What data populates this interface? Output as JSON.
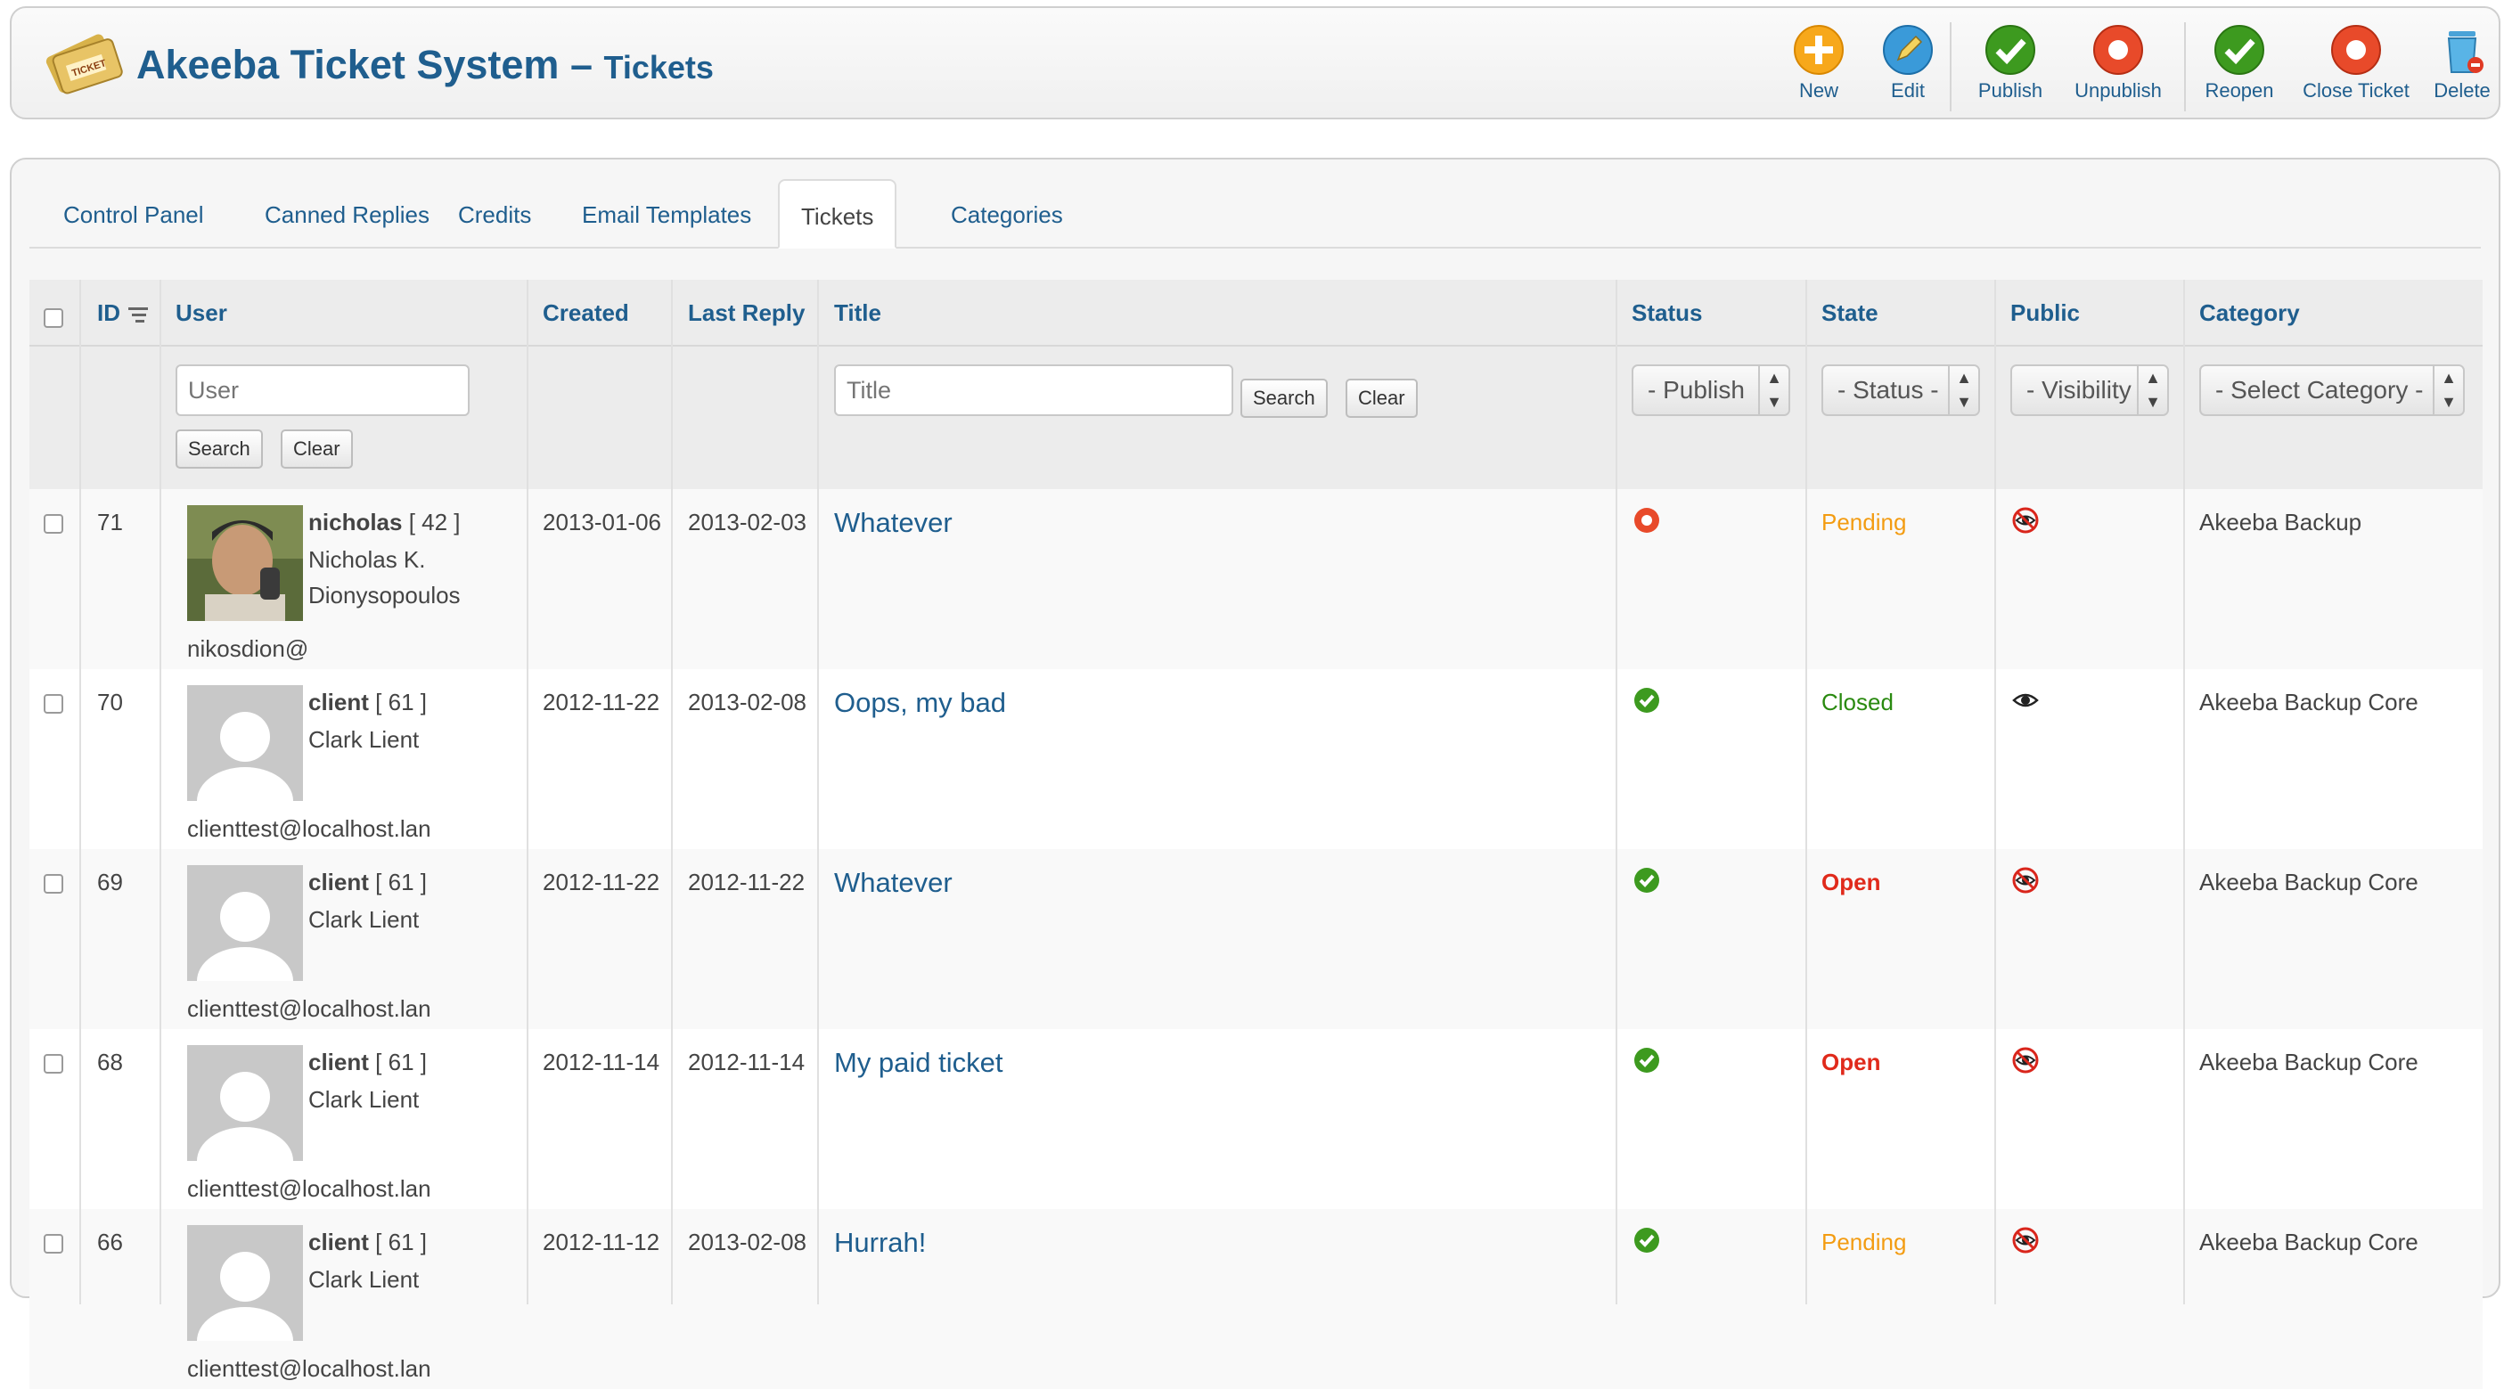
{
  "app": {
    "title": "Akeeba Ticket System",
    "dash": "–",
    "subtitle": "Tickets"
  },
  "toolbar": {
    "buttons": [
      {
        "label": "New",
        "icon": "plus-icon"
      },
      {
        "label": "Edit",
        "icon": "pencil-icon"
      },
      {
        "label": "Publish",
        "icon": "check-icon"
      },
      {
        "label": "Unpublish",
        "icon": "stop-icon"
      },
      {
        "label": "Reopen",
        "icon": "check-icon"
      },
      {
        "label": "Close Ticket",
        "icon": "stop-icon"
      },
      {
        "label": "Delete",
        "icon": "trash-icon"
      }
    ]
  },
  "tabs": [
    {
      "label": "Control Panel",
      "active": false
    },
    {
      "label": "Canned Replies",
      "active": false
    },
    {
      "label": "Credits",
      "active": false
    },
    {
      "label": "Email Templates",
      "active": false
    },
    {
      "label": "Tickets",
      "active": true
    },
    {
      "label": "Categories",
      "active": false
    }
  ],
  "table": {
    "columns": {
      "id": "ID",
      "user": "User",
      "created": "Created",
      "last_reply": "Last Reply",
      "title": "Title",
      "status": "Status",
      "state": "State",
      "public": "Public",
      "category": "Category"
    },
    "filters": {
      "user_placeholder": "User",
      "title_placeholder": "Title",
      "search_label": "Search",
      "clear_label": "Clear",
      "status_select": "- Publish",
      "state_select": "- Status -",
      "public_select": "- Visibility",
      "category_select": "- Select Category -"
    },
    "rows": [
      {
        "id": "71",
        "username": "nicholas",
        "userid": "[ 42 ]",
        "name_line1": "Nicholas K.",
        "name_line2": "Dionysopoulos",
        "email": "nikosdion@",
        "avatar": "photo",
        "created": "2013-01-06",
        "last_reply": "2013-02-03",
        "title": "Whatever",
        "published": false,
        "state": "Pending",
        "state_class": "pending",
        "public": false,
        "category": "Akeeba Backup"
      },
      {
        "id": "70",
        "username": "client",
        "userid": "[ 61 ]",
        "name_line1": "Clark Lient",
        "name_line2": "",
        "email": "clienttest@localhost.lan",
        "avatar": "placeholder",
        "created": "2012-11-22",
        "last_reply": "2013-02-08",
        "title": "Oops, my bad",
        "published": true,
        "state": "Closed",
        "state_class": "closed",
        "public": true,
        "category": "Akeeba Backup Core"
      },
      {
        "id": "69",
        "username": "client",
        "userid": "[ 61 ]",
        "name_line1": "Clark Lient",
        "name_line2": "",
        "email": "clienttest@localhost.lan",
        "avatar": "placeholder",
        "created": "2012-11-22",
        "last_reply": "2012-11-22",
        "title": "Whatever",
        "published": true,
        "state": "Open",
        "state_class": "open",
        "public": false,
        "category": "Akeeba Backup Core"
      },
      {
        "id": "68",
        "username": "client",
        "userid": "[ 61 ]",
        "name_line1": "Clark Lient",
        "name_line2": "",
        "email": "clienttest@localhost.lan",
        "avatar": "placeholder",
        "created": "2012-11-14",
        "last_reply": "2012-11-14",
        "title": "My paid ticket",
        "published": true,
        "state": "Open",
        "state_class": "open",
        "public": false,
        "category": "Akeeba Backup Core"
      },
      {
        "id": "66",
        "username": "client",
        "userid": "[ 61 ]",
        "name_line1": "Clark Lient",
        "name_line2": "",
        "email": "clienttest@localhost.lan",
        "avatar": "placeholder",
        "created": "2012-11-12",
        "last_reply": "2013-02-08",
        "title": "Hurrah!",
        "published": true,
        "state": "Pending",
        "state_class": "pending",
        "public": false,
        "category": "Akeeba Backup Core"
      }
    ]
  },
  "colors": {
    "link": "#1f5e8e",
    "pending": "#f39c12",
    "closed": "#2a8a10",
    "open": "#e02a1b"
  }
}
